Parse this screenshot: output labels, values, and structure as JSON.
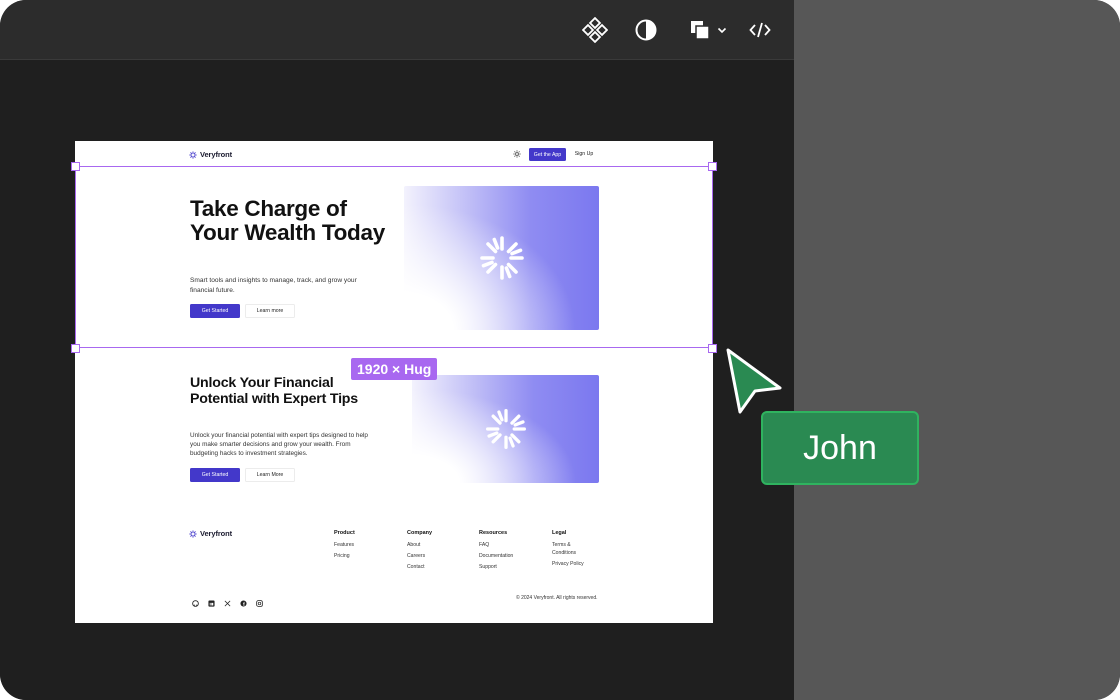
{
  "toolbar": {
    "icons": [
      "components-icon",
      "contrast-icon",
      "layers-icon",
      "chevron-down-icon",
      "code-icon"
    ]
  },
  "page": {
    "nav": {
      "brand": "Veryfront",
      "cta_label": "Get the App",
      "signup_label": "Sign Up"
    },
    "hero": {
      "title": "Take Charge of Your Wealth Today",
      "subtitle": "Smart tools and insights to manage, track, and grow your financial future.",
      "primary_label": "Get Started",
      "secondary_label": "Learn more"
    },
    "feature": {
      "title": "Unlock Your Financial Potential with Expert Tips",
      "body": "Unlock your financial potential with expert tips designed to help you make smarter decisions and grow your wealth. From budgeting hacks to investment strategies.",
      "primary_label": "Get Started",
      "secondary_label": "Learn More"
    },
    "footer": {
      "brand": "Veryfront",
      "columns": [
        {
          "heading": "Product",
          "links": [
            "Features",
            "Pricing"
          ]
        },
        {
          "heading": "Company",
          "links": [
            "About",
            "Careers",
            "Contact"
          ]
        },
        {
          "heading": "Resources",
          "links": [
            "FAQ",
            "Documentation",
            "Support"
          ]
        },
        {
          "heading": "Legal",
          "links": [
            "Terms & Conditions",
            "Privacy Policy"
          ]
        }
      ],
      "socials": [
        "github-icon",
        "linkedin-icon",
        "x-icon",
        "facebook-icon",
        "instagram-icon"
      ],
      "copyright": "© 2024 Veryfront. All rights reserved."
    }
  },
  "selection": {
    "size_label": "1920 × Hug"
  },
  "collaborator": {
    "name": "John",
    "color": "#2a8a52"
  },
  "colors": {
    "accent": "#4338ca",
    "selection": "#a868f0",
    "collaborator": "#2fb35f"
  }
}
